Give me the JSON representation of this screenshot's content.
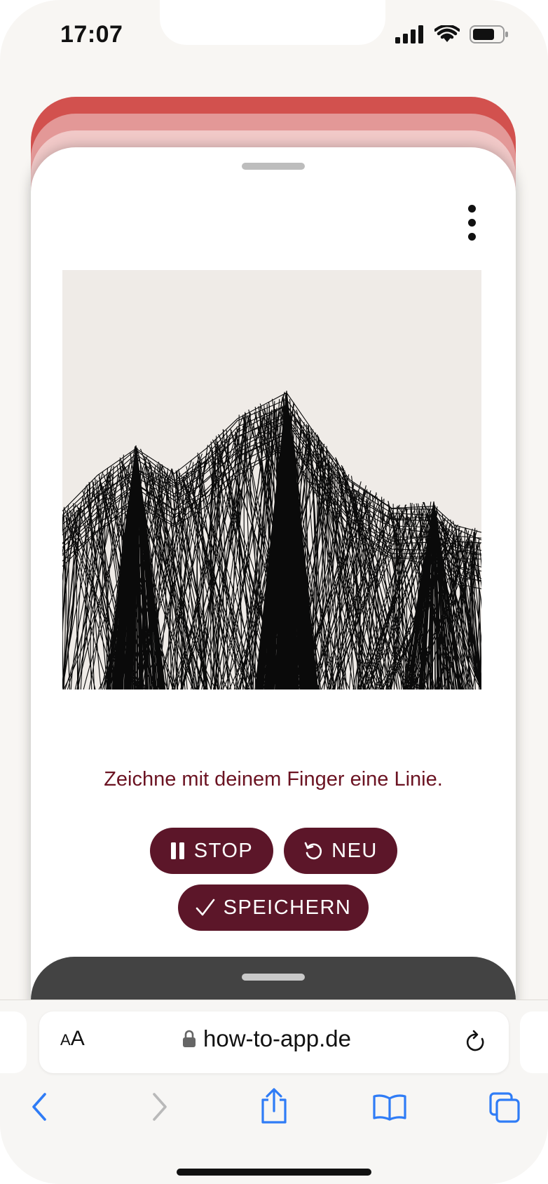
{
  "status_bar": {
    "time": "17:07"
  },
  "card": {
    "hint": "Zeichne mit deinem Finger eine Linie.",
    "buttons": {
      "stop": "STOP",
      "neu": "NEU",
      "save": "SPEICHERN"
    }
  },
  "browser": {
    "text_size_label_small": "A",
    "text_size_label_large": "A",
    "url": "how-to-app.de"
  },
  "colors": {
    "accent_button": "#5c1629",
    "hint_text": "#6b1322",
    "stack_red": "#d2514e",
    "canvas_bg": "#efebe7",
    "ios_blue": "#2f7cf6"
  },
  "icons": [
    "signal-icon",
    "wifi-icon",
    "battery-icon",
    "more-vertical-icon",
    "pause-icon",
    "restart-icon",
    "check-icon",
    "lock-icon",
    "reload-icon",
    "back-icon",
    "forward-icon",
    "share-icon",
    "bookmarks-icon",
    "tabs-icon"
  ]
}
